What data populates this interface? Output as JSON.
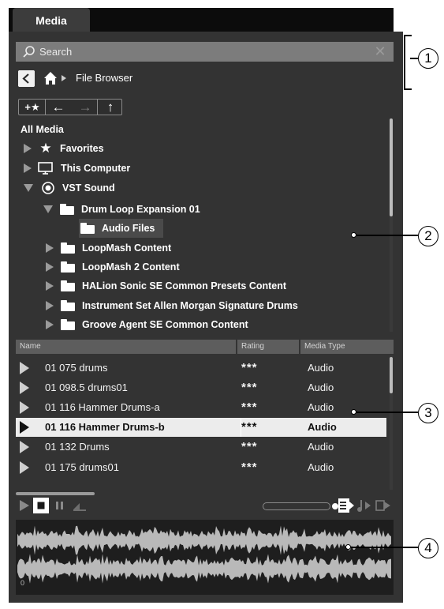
{
  "tab": {
    "label": "Media"
  },
  "search": {
    "placeholder": "Search",
    "clear_icon": "close-icon"
  },
  "nav": {
    "back_icon": "chevron-left-icon",
    "home_icon": "home-icon",
    "breadcrumb": "File Browser"
  },
  "toolbar": {
    "add_favorite": "+★",
    "back": "←",
    "forward": "→",
    "up": "↑"
  },
  "tree": {
    "root_label": "All Media",
    "items": [
      {
        "label": "Favorites",
        "icon": "star-icon",
        "expanded": false,
        "level": 1
      },
      {
        "label": "This Computer",
        "icon": "monitor-icon",
        "expanded": false,
        "level": 1
      },
      {
        "label": "VST Sound",
        "icon": "vst-sound-icon",
        "expanded": true,
        "level": 1
      },
      {
        "label": "Drum Loop Expansion 01",
        "icon": "folder-icon",
        "expanded": true,
        "level": 2
      },
      {
        "label": "Audio Files",
        "icon": "folder-icon",
        "selected": true,
        "level": 3
      },
      {
        "label": "LoopMash Content",
        "icon": "folder-icon",
        "expanded": false,
        "level": 2
      },
      {
        "label": "LoopMash 2 Content",
        "icon": "folder-icon",
        "expanded": false,
        "level": 2
      },
      {
        "label": "HALion Sonic SE Common Presets Content",
        "icon": "folder-icon",
        "expanded": false,
        "level": 2
      },
      {
        "label": "Instrument Set Allen Morgan Signature Drums",
        "icon": "folder-icon",
        "expanded": false,
        "level": 2
      },
      {
        "label": "Groove Agent SE Common Content",
        "icon": "folder-icon",
        "expanded": false,
        "level": 2
      }
    ]
  },
  "results": {
    "columns": [
      "Name",
      "Rating",
      "Media Type"
    ],
    "rows": [
      {
        "name": "01 075 drums",
        "rating": "***",
        "type": "Audio"
      },
      {
        "name": "01 098.5 drums01",
        "rating": "***",
        "type": "Audio"
      },
      {
        "name": "01 116 Hammer Drums-a",
        "rating": "***",
        "type": "Audio"
      },
      {
        "name": "01 116 Hammer Drums-b",
        "rating": "***",
        "type": "Audio",
        "selected": true
      },
      {
        "name": "01 132 Drums",
        "rating": "***",
        "type": "Audio"
      },
      {
        "name": "01 175 drums01",
        "rating": "***",
        "type": "Audio"
      }
    ]
  },
  "transport": {
    "play_icon": "play-icon",
    "stop_icon": "stop-icon",
    "pause_icon": "pause-icon",
    "loop_icon": "loop-icon",
    "volume_level": 0.9,
    "autoplay_icon": "autoplay-icon",
    "music_mode_icon": "music-note-icon",
    "insert_icon": "insert-icon"
  },
  "waveform": {
    "start_marker": "0"
  },
  "callouts": [
    "1",
    "2",
    "3",
    "4"
  ],
  "colors": {
    "panel": "#333333",
    "accent_selected_row": "#ececec",
    "tab_bar": "#0c0c0c"
  }
}
